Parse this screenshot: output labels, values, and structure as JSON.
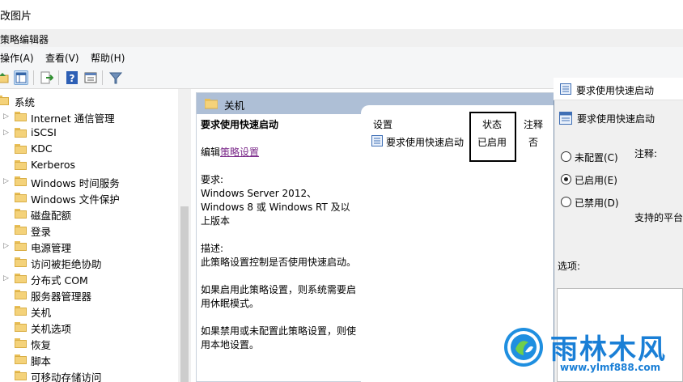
{
  "window": {
    "title_partial": "改图片",
    "app_title_partial": "策略编辑器"
  },
  "menu": [
    {
      "label": "操作(A)"
    },
    {
      "label": "查看(V)"
    },
    {
      "label": "帮助(H)"
    }
  ],
  "toolbar": {
    "icons": [
      "folder-up-icon",
      "show-hide-tree-icon",
      "export-list-icon",
      "help-icon",
      "properties-icon",
      "filter-icon"
    ]
  },
  "tree": {
    "items": [
      {
        "label": "系统",
        "expandable": false
      },
      {
        "label": "Internet 通信管理",
        "expandable": true
      },
      {
        "label": "iSCSI",
        "expandable": true
      },
      {
        "label": "KDC",
        "expandable": false
      },
      {
        "label": "Kerberos",
        "expandable": false
      },
      {
        "label": "Windows 时间服务",
        "expandable": true
      },
      {
        "label": "Windows 文件保护",
        "expandable": false
      },
      {
        "label": "磁盘配额",
        "expandable": false
      },
      {
        "label": "登录",
        "expandable": false
      },
      {
        "label": "电源管理",
        "expandable": true
      },
      {
        "label": "访问被拒绝协助",
        "expandable": false
      },
      {
        "label": "分布式 COM",
        "expandable": true
      },
      {
        "label": "服务器管理器",
        "expandable": false
      },
      {
        "label": "关机",
        "expandable": false,
        "selected": true
      },
      {
        "label": "关机选项",
        "expandable": false
      },
      {
        "label": "恢复",
        "expandable": false
      },
      {
        "label": "脚本",
        "expandable": false
      },
      {
        "label": "可移动存储访问",
        "expandable": false
      }
    ]
  },
  "right_pane": {
    "header": "关机",
    "description": {
      "title": "要求使用快速启动",
      "edit_prefix": "编辑",
      "edit_link": "策略设置",
      "req_label": "要求:",
      "req_text": "Windows Server 2012、Windows 8 或 Windows RT 及以上版本",
      "desc_label": "描述:",
      "desc_text": "此策略设置控制是否使用快速启动。",
      "enabled_text": "如果启用此策略设置，则系统需要启用休眠模式。",
      "disabled_text": "如果禁用或未配置此策略设置，则使用本地设置。"
    },
    "table": {
      "columns": [
        "设置",
        "状态",
        "注释"
      ],
      "rows": [
        {
          "setting": "要求使用快速启动",
          "state": "已启用",
          "comment": "否"
        }
      ]
    }
  },
  "dialog": {
    "title": "要求使用快速启动",
    "setting_name": "要求使用快速启动",
    "options": [
      {
        "label": "未配置(C)",
        "selected": false
      },
      {
        "label": "已启用(E)",
        "selected": true
      },
      {
        "label": "已禁用(D)",
        "selected": false
      }
    ],
    "comment_label": "注释:",
    "supported_label_partial": "支持的平台",
    "options_label": "选项:"
  },
  "watermark": {
    "title": "雨林木风",
    "url": "www.ylmf888.com"
  }
}
